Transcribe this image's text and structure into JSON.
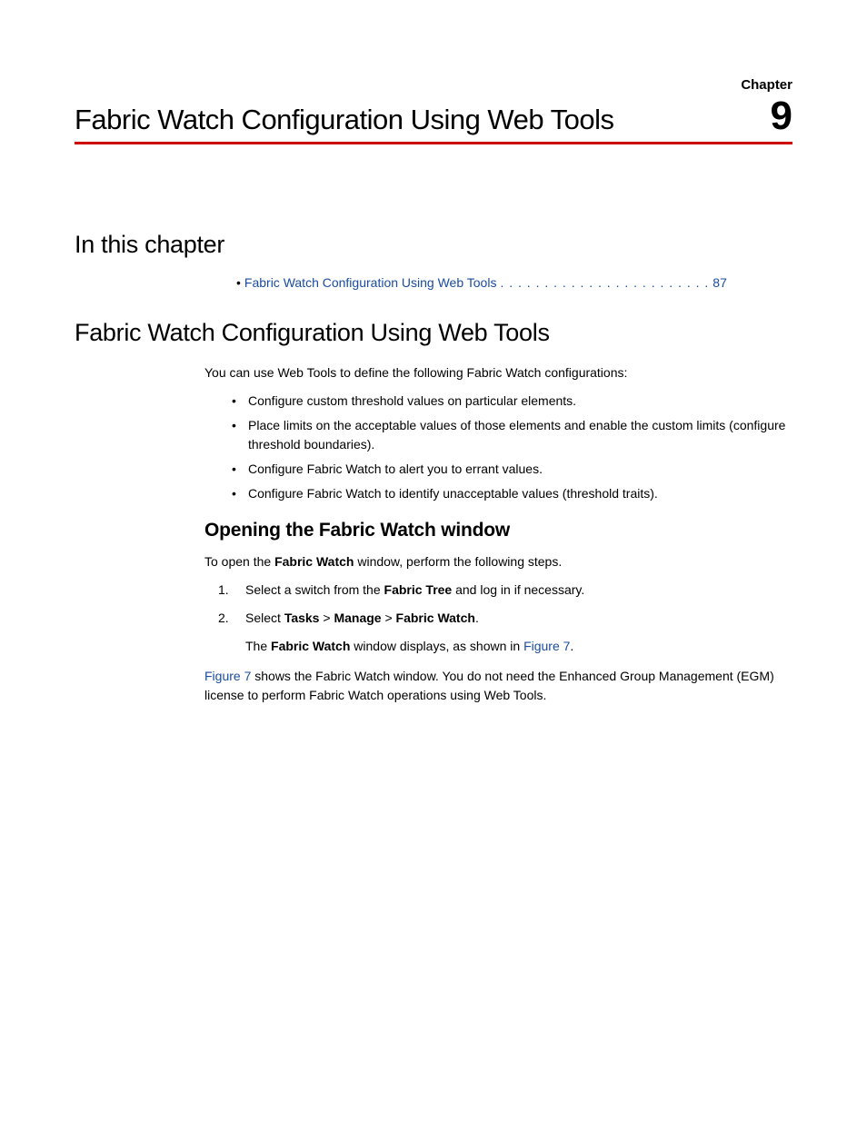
{
  "header": {
    "title": "Fabric Watch Configuration Using Web Tools",
    "chapter_label": "Chapter",
    "chapter_number": "9"
  },
  "sections": {
    "in_this_chapter_heading": "In this chapter",
    "toc_link_text": "Fabric Watch Configuration Using Web Tools",
    "toc_dots": ". . . . . . . . . . . . . . . . . . . . . . . .",
    "toc_page": "87",
    "main_heading": "Fabric Watch Configuration Using Web Tools",
    "intro_text": "You can use Web Tools to define the following Fabric Watch configurations:",
    "bullets": [
      "Configure custom threshold values on particular elements.",
      "Place limits on the acceptable values of those elements and enable the custom limits (configure threshold boundaries).",
      "Configure Fabric Watch to alert you to errant values.",
      "Configure Fabric Watch to identify unacceptable values (threshold traits)."
    ],
    "sub_heading": "Opening the Fabric Watch window",
    "open_intro_pre": "To open the ",
    "open_intro_bold": "Fabric Watch",
    "open_intro_post": " window, perform the following steps.",
    "step1_pre": "Select a switch from the ",
    "step1_bold": "Fabric Tree",
    "step1_post": " and log in if necessary.",
    "step2_pre": "Select ",
    "step2_b1": "Tasks",
    "step2_gt1": " > ",
    "step2_b2": "Manage",
    "step2_gt2": " > ",
    "step2_b3": "Fabric Watch",
    "step2_post": ".",
    "step_sub_pre": "The ",
    "step_sub_bold": "Fabric Watch",
    "step_sub_mid": " window displays, as shown in ",
    "step_sub_link": "Figure 7",
    "step_sub_post": ".",
    "closing_link": "Figure 7",
    "closing_text": " shows the Fabric Watch window. You do not need the Enhanced Group Management (EGM) license to perform Fabric Watch operations using Web Tools."
  }
}
